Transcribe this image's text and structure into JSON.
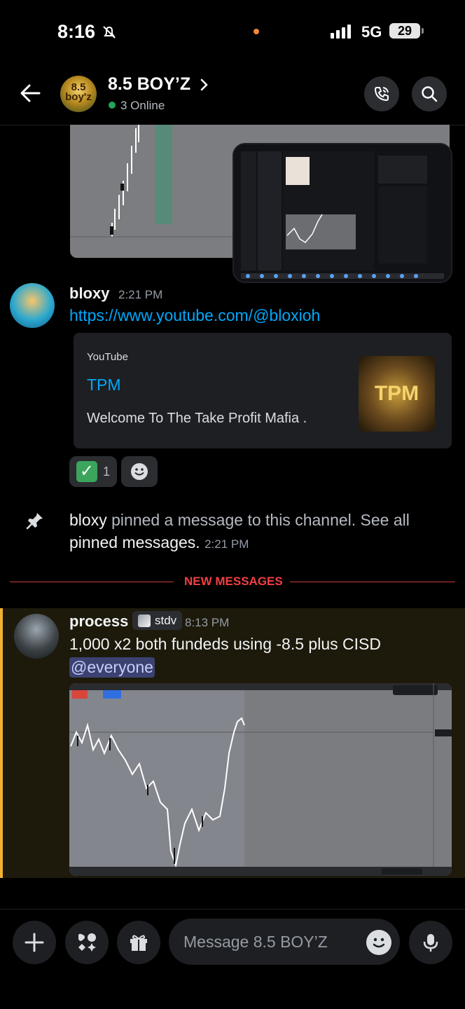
{
  "status_bar": {
    "time": "8:16",
    "network": "5G",
    "battery": "29"
  },
  "header": {
    "server_icon_text": "8.5 boy'z",
    "title": "8.5 BOY’Z",
    "online": "3 Online"
  },
  "messages": [
    {
      "author": "bloxy",
      "time": "2:21 PM",
      "link": "https://www.youtube.com/@bloxioh",
      "embed": {
        "provider": "YouTube",
        "title": "TPM",
        "description": "Welcome To The Take Profit Mafia .",
        "thumb_text": "TPM"
      },
      "reaction": {
        "emoji": "check-mark",
        "count": "1"
      }
    }
  ],
  "system": {
    "actor": "bloxy",
    "text": " pinned a message to this channel. See all ",
    "link": "pinned messages.",
    "time": "2:21 PM"
  },
  "divider": {
    "label": "NEW MESSAGES"
  },
  "new_message": {
    "author": "process",
    "role": "stdv",
    "time": "8:13 PM",
    "text": "1,000 x2 both fundeds using -8.5 plus CISD",
    "mention": "@everyone"
  },
  "composer": {
    "placeholder": "Message 8.5 BOY’Z"
  },
  "colors": {
    "accent_link": "#00a8fc",
    "new_divider": "#f23f43",
    "mention_bar": "#f0b232",
    "online": "#23a559"
  }
}
